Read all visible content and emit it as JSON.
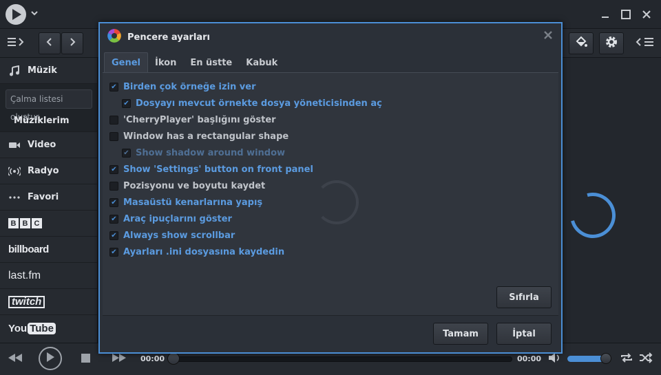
{
  "sidebar": {
    "items": [
      {
        "label": "Müzik",
        "icon": "music-note-icon"
      },
      {
        "label": "Video",
        "icon": "video-camera-icon"
      },
      {
        "label": "Radyo",
        "icon": "radio-waves-icon"
      },
      {
        "label": "Favori",
        "icon": "more-dots-icon"
      }
    ],
    "playlist_placeholder": "Çalma listesi oluştur...",
    "my_music_label": "Müziklerim",
    "brands": [
      "BBC",
      "billboard",
      "last.fm",
      "twitch",
      "YouTube"
    ]
  },
  "dialog": {
    "title": "Pencere ayarları",
    "tabs": [
      "Genel",
      "İkon",
      "En üstte",
      "Kabuk"
    ],
    "active_tab": "Genel",
    "options": [
      {
        "label": "Birden çok örneğe izin ver",
        "checked": true,
        "enabled": true,
        "indent": 0
      },
      {
        "label": "Dosyayı mevcut örnekte dosya yöneticisinden aç",
        "checked": true,
        "enabled": true,
        "indent": 1
      },
      {
        "label": "'CherryPlayer' başlığını göster",
        "checked": false,
        "enabled": true,
        "indent": 0
      },
      {
        "label": "Window has a rectangular shape",
        "checked": false,
        "enabled": true,
        "indent": 0
      },
      {
        "label": "Show shadow around window",
        "checked": true,
        "enabled": false,
        "indent": 1
      },
      {
        "label": "Show 'Settings' button on front panel",
        "checked": true,
        "enabled": true,
        "indent": 0
      },
      {
        "label": "Pozisyonu ve boyutu kaydet",
        "checked": false,
        "enabled": true,
        "indent": 0
      },
      {
        "label": "Masaüstü kenarlarına yapış",
        "checked": true,
        "enabled": true,
        "indent": 0
      },
      {
        "label": "Araç ipuçlarını göster",
        "checked": true,
        "enabled": true,
        "indent": 0
      },
      {
        "label": "Always show scrollbar",
        "checked": true,
        "enabled": true,
        "indent": 0
      },
      {
        "label": "Ayarları .ini dosyasına kaydedin",
        "checked": true,
        "enabled": true,
        "indent": 0
      }
    ],
    "reset_label": "Sıfırla",
    "ok_label": "Tamam",
    "cancel_label": "İptal"
  },
  "player": {
    "time_current": "00:00",
    "time_total": "00:00",
    "progress": 0,
    "volume": 0.9
  },
  "colors": {
    "accent": "#4b8fd6",
    "checked_text": "#5b9be0",
    "background": "#1e2228"
  }
}
